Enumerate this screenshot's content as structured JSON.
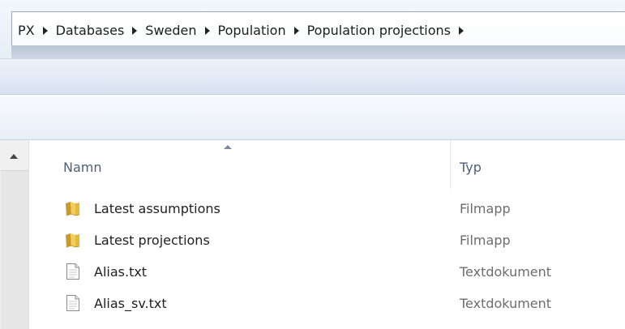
{
  "breadcrumb": {
    "items": [
      "PX",
      "Databases",
      "Sweden",
      "Population",
      "Population projections"
    ]
  },
  "columns": {
    "name": "Namn",
    "type": "Typ",
    "sort": "ascending"
  },
  "files": [
    {
      "name": "Latest assumptions",
      "type": "Filmapp",
      "icon": "folder-icon"
    },
    {
      "name": "Latest projections",
      "type": "Filmapp",
      "icon": "folder-icon"
    },
    {
      "name": "Alias.txt",
      "type": "Textdokument",
      "icon": "text-file-icon"
    },
    {
      "name": "Alias_sv.txt",
      "type": "Textdokument",
      "icon": "text-file-icon"
    }
  ],
  "colors": {
    "folder": "#e8c24a",
    "header_text": "#4c607a",
    "type_text": "#6d6d6d"
  }
}
